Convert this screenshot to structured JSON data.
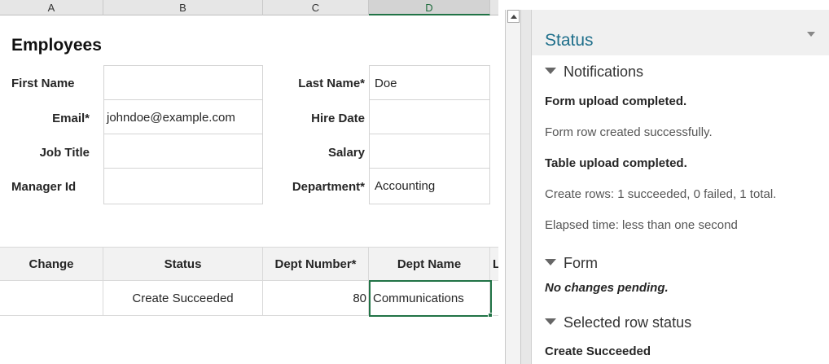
{
  "column_headers": [
    "A",
    "B",
    "C",
    "D"
  ],
  "form": {
    "title": "Employees",
    "first_name_label": "First Name",
    "first_name_value": "",
    "last_name_label": "Last Name*",
    "last_name_value": "Doe",
    "email_label": "Email*",
    "email_value": "johndoe@example.com",
    "hire_date_label": "Hire Date",
    "hire_date_value": "",
    "job_title_label": "Job Title",
    "job_title_value": "",
    "salary_label": "Salary",
    "salary_value": "",
    "manager_id_label": "Manager Id",
    "manager_id_value": "",
    "department_label": "Department*",
    "department_value": "Accounting"
  },
  "table": {
    "columns": [
      "Change",
      "Status",
      "Dept Number*",
      "Dept Name",
      "Lo"
    ],
    "rows": [
      {
        "change": "",
        "status": "Create Succeeded",
        "dept_number": "80",
        "dept_name": "Communications"
      }
    ]
  },
  "status_pane": {
    "title": "Status",
    "notifications_heading": "Notifications",
    "notifications": [
      "Form upload completed.",
      "Form row created successfully.",
      "Table upload completed.",
      "Create rows: 1 succeeded, 0 failed, 1 total.",
      "Elapsed time: less than one second"
    ],
    "form_heading": "Form",
    "form_message": "No changes pending.",
    "selected_row_heading": "Selected row status",
    "selected_row_message": "Create Succeeded"
  },
  "colors": {
    "accent_green": "#217346",
    "pane_title_blue": "#1f6f8b"
  }
}
